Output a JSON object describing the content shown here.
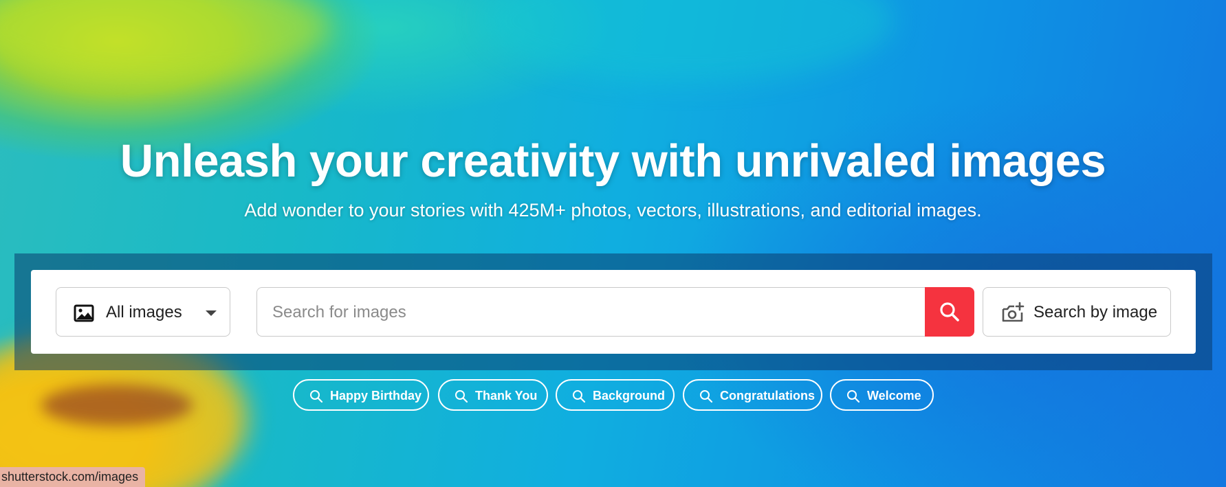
{
  "hero": {
    "headline": "Unleash your creativity with unrivaled images",
    "subheadline": "Add wonder to your stories with 425M+ photos, vectors, illustrations, and editorial images."
  },
  "search": {
    "type_selector": {
      "selected": "All images",
      "icon": "image-icon"
    },
    "input": {
      "placeholder": "Search for images",
      "value": ""
    },
    "submit_icon": "search-icon",
    "search_by_image": {
      "label": "Search by image",
      "icon": "camera-plus-icon"
    }
  },
  "suggestions": [
    {
      "label": "Happy Birthday"
    },
    {
      "label": "Thank You"
    },
    {
      "label": "Background"
    },
    {
      "label": "Congratulations"
    },
    {
      "label": "Welcome"
    }
  ],
  "status_bar": {
    "url": "shutterstock.com/images"
  },
  "colors": {
    "accent_red": "#f5333f",
    "chip_border": "#ffffff"
  }
}
